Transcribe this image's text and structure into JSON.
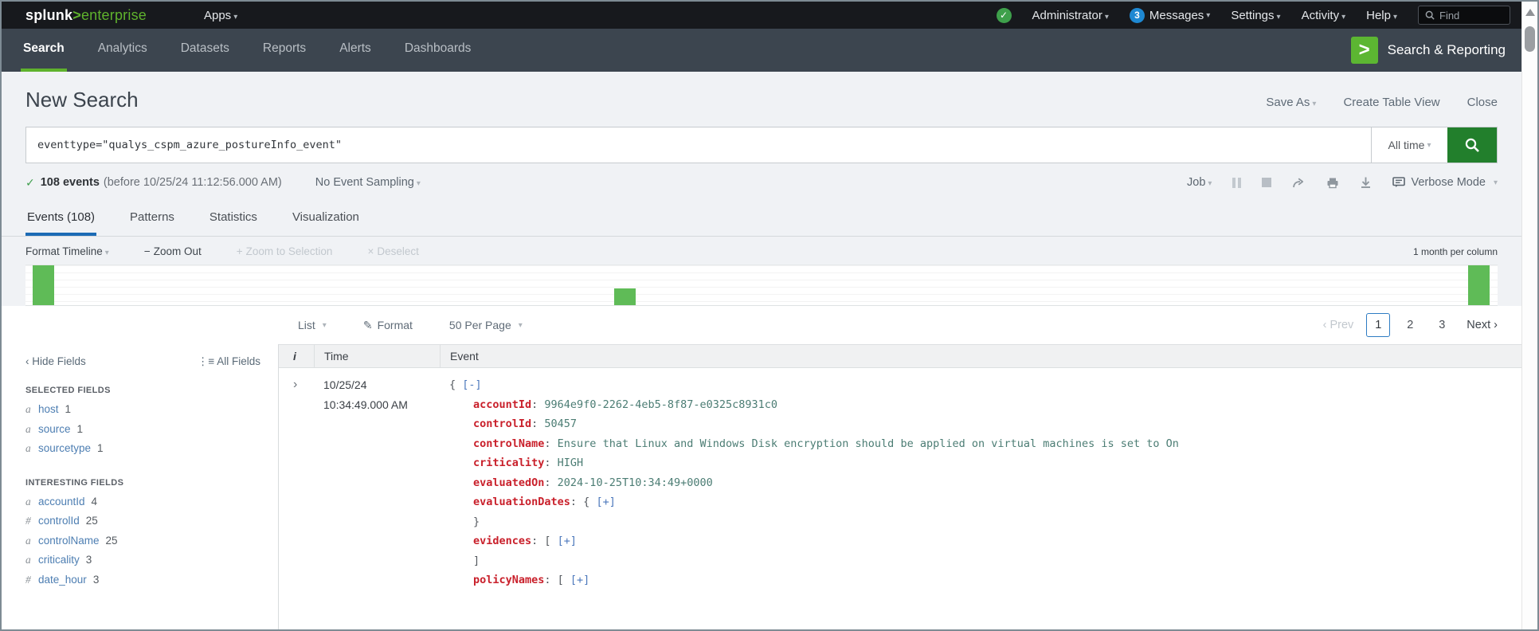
{
  "colors": {
    "splunk_green": "#5fb22d",
    "app_icon_green": "#5cb632",
    "search_button_green": "#227f2c",
    "timeline_bar_green": "#5fbb57",
    "messages_badge_blue": "#1e88d2",
    "active_tab_blue": "#1c6bb5",
    "json_key_red": "#c9202b",
    "json_value_teal": "#4c7d74",
    "json_link_blue": "#4c78bc"
  },
  "icons": {
    "caret_down": "▾",
    "check": "✓",
    "chevron_left": "‹",
    "chevron_right": "›",
    "minus": "−",
    "plus": "+",
    "x": "×",
    "fields_list": "⋮≡",
    "pencil": "✎",
    "expand_chevron": "›",
    "gt": ">"
  },
  "topbar": {
    "logo_splunk": "splunk",
    "logo_gt": ">",
    "logo_product": "enterprise",
    "apps_label": "Apps",
    "user_label": "Administrator",
    "messages_count": "3",
    "messages_label": "Messages",
    "settings_label": "Settings",
    "activity_label": "Activity",
    "help_label": "Help",
    "find_placeholder": "Find"
  },
  "appbar": {
    "tabs": [
      {
        "label": "Search",
        "active": true
      },
      {
        "label": "Analytics",
        "active": false
      },
      {
        "label": "Datasets",
        "active": false
      },
      {
        "label": "Reports",
        "active": false
      },
      {
        "label": "Alerts",
        "active": false
      },
      {
        "label": "Dashboards",
        "active": false
      }
    ],
    "app_name": "Search & Reporting"
  },
  "search": {
    "title": "New Search",
    "save_as_label": "Save As",
    "create_table_view_label": "Create Table View",
    "close_label": "Close",
    "query": "eventtype=\"qualys_cspm_azure_postureInfo_event\"",
    "time_range": "All time"
  },
  "job": {
    "result_count": "108 events",
    "result_detail": "(before 10/25/24 11:12:56.000 AM)",
    "sampling_label": "No Event Sampling",
    "job_label": "Job",
    "mode_label": "Verbose Mode"
  },
  "result_tabs": [
    {
      "label": "Events (108)",
      "active": true
    },
    {
      "label": "Patterns",
      "active": false
    },
    {
      "label": "Statistics",
      "active": false
    },
    {
      "label": "Visualization",
      "active": false
    }
  ],
  "timeline": {
    "format_label": "Format Timeline",
    "zoom_out_label": "Zoom Out",
    "zoom_selection_label": "Zoom to Selection",
    "deselect_label": "Deselect",
    "scale_label": "1 month per column",
    "bars": [
      {
        "left_pct": 0.5,
        "height_pct": 100
      },
      {
        "left_pct": 40.0,
        "height_pct": 42
      },
      {
        "left_pct": 98.0,
        "height_pct": 100
      }
    ]
  },
  "results_toolbar": {
    "list_label": "List",
    "format_label": "Format",
    "per_page_label": "50 Per Page",
    "pagination": {
      "prev_label": "Prev",
      "pages": [
        "1",
        "2",
        "3"
      ],
      "current_page": "1",
      "next_label": "Next"
    }
  },
  "fields_panel": {
    "hide_label": "Hide Fields",
    "all_label": "All Fields",
    "selected_header": "SELECTED FIELDS",
    "selected_fields": [
      {
        "type": "a",
        "name": "host",
        "count": "1"
      },
      {
        "type": "a",
        "name": "source",
        "count": "1"
      },
      {
        "type": "a",
        "name": "sourcetype",
        "count": "1"
      }
    ],
    "interesting_header": "INTERESTING FIELDS",
    "interesting_fields": [
      {
        "type": "a",
        "name": "accountId",
        "count": "4"
      },
      {
        "type": "#",
        "name": "controlId",
        "count": "25"
      },
      {
        "type": "a",
        "name": "controlName",
        "count": "25"
      },
      {
        "type": "a",
        "name": "criticality",
        "count": "3"
      },
      {
        "type": "#",
        "name": "date_hour",
        "count": "3"
      }
    ]
  },
  "events_table": {
    "col_info": "i",
    "col_time": "Time",
    "col_event": "Event",
    "rows": [
      {
        "date": "10/25/24",
        "time": "10:34:49.000 AM",
        "json_lines": [
          {
            "indent": 0,
            "parts": [
              {
                "t": "{ ",
                "c": "plain"
              },
              {
                "t": "[-]",
                "c": "link"
              }
            ]
          },
          {
            "indent": 1,
            "parts": [
              {
                "t": "accountId",
                "c": "key"
              },
              {
                "t": ": ",
                "c": "plain"
              },
              {
                "t": "9964e9f0-2262-4eb5-8f87-e0325c8931c0",
                "c": "value"
              }
            ]
          },
          {
            "indent": 1,
            "parts": [
              {
                "t": "controlId",
                "c": "key"
              },
              {
                "t": ": ",
                "c": "plain"
              },
              {
                "t": "50457",
                "c": "value"
              }
            ]
          },
          {
            "indent": 1,
            "parts": [
              {
                "t": "controlName",
                "c": "key"
              },
              {
                "t": ": ",
                "c": "plain"
              },
              {
                "t": "Ensure that Linux and Windows Disk encryption should be applied on virtual machines is set to On",
                "c": "value"
              }
            ]
          },
          {
            "indent": 1,
            "parts": [
              {
                "t": "criticality",
                "c": "key"
              },
              {
                "t": ": ",
                "c": "plain"
              },
              {
                "t": "HIGH",
                "c": "value"
              }
            ]
          },
          {
            "indent": 1,
            "parts": [
              {
                "t": "evaluatedOn",
                "c": "key"
              },
              {
                "t": ": ",
                "c": "plain"
              },
              {
                "t": "2024-10-25T10:34:49+0000",
                "c": "value"
              }
            ]
          },
          {
            "indent": 1,
            "parts": [
              {
                "t": "evaluationDates",
                "c": "key"
              },
              {
                "t": ": { ",
                "c": "plain"
              },
              {
                "t": "[+]",
                "c": "link"
              }
            ]
          },
          {
            "indent": 1,
            "parts": [
              {
                "t": "}",
                "c": "plain"
              }
            ]
          },
          {
            "indent": 1,
            "parts": [
              {
                "t": "evidences",
                "c": "key"
              },
              {
                "t": ": [ ",
                "c": "plain"
              },
              {
                "t": "[+]",
                "c": "link"
              }
            ]
          },
          {
            "indent": 1,
            "parts": [
              {
                "t": "]",
                "c": "plain"
              }
            ]
          },
          {
            "indent": 1,
            "parts": [
              {
                "t": "policyNames",
                "c": "key"
              },
              {
                "t": ": [ ",
                "c": "plain"
              },
              {
                "t": "[+]",
                "c": "link"
              }
            ]
          }
        ]
      }
    ]
  }
}
